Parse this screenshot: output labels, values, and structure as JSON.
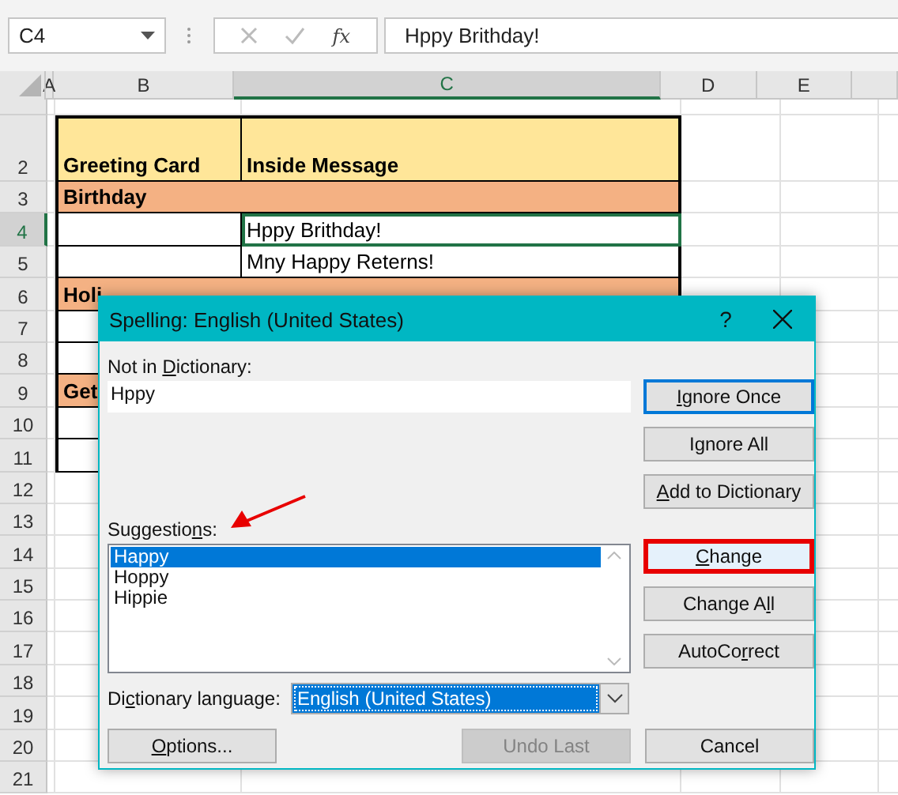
{
  "formula_bar": {
    "name_box": "C4",
    "function_label": "fx",
    "formula": "Hppy Brithday!"
  },
  "columns": [
    {
      "label": "A",
      "selected": false
    },
    {
      "label": "B",
      "selected": false
    },
    {
      "label": "C",
      "selected": true
    },
    {
      "label": "D",
      "selected": false
    },
    {
      "label": "E",
      "selected": false
    }
  ],
  "rows": [
    {
      "number": "2",
      "selected": false,
      "kind": "header",
      "cells": [
        {
          "text": "Greeting Card",
          "selected": false
        },
        {
          "text": "Inside Message",
          "selected": false
        }
      ]
    },
    {
      "number": "3",
      "selected": false,
      "kind": "section",
      "cells": [
        {
          "text": "Birthday",
          "selected": false
        }
      ]
    },
    {
      "number": "4",
      "selected": true,
      "kind": "data",
      "cells": [
        {
          "selected": false
        },
        {
          "text": "Hppy Brithday!",
          "selected": true
        }
      ]
    },
    {
      "number": "5",
      "selected": false,
      "kind": "data",
      "cells": [
        {
          "selected": false
        },
        {
          "text": "Mny Happy Reterns!",
          "selected": false
        }
      ]
    },
    {
      "number": "6",
      "selected": false,
      "kind": "section",
      "cells": [
        {
          "text": "Holi",
          "selected": false
        }
      ]
    },
    {
      "number": "7",
      "selected": false,
      "kind": "boxed"
    },
    {
      "number": "8",
      "selected": false,
      "kind": "boxed"
    },
    {
      "number": "9",
      "selected": false,
      "kind": "section",
      "cells": [
        {
          "text": "Get",
          "selected": false
        }
      ]
    },
    {
      "number": "10",
      "selected": false,
      "kind": "boxed"
    },
    {
      "number": "11",
      "selected": false,
      "kind": "boxed"
    },
    {
      "number": "12",
      "selected": false,
      "kind": "plain"
    },
    {
      "number": "13",
      "selected": false,
      "kind": "plain"
    },
    {
      "number": "14",
      "selected": false,
      "kind": "plain"
    },
    {
      "number": "15",
      "selected": false,
      "kind": "plain"
    },
    {
      "number": "16",
      "selected": false,
      "kind": "plain"
    },
    {
      "number": "17",
      "selected": false,
      "kind": "plain"
    },
    {
      "number": "18",
      "selected": false,
      "kind": "plain"
    },
    {
      "number": "19",
      "selected": false,
      "kind": "plain"
    },
    {
      "number": "20",
      "selected": false,
      "kind": "plain"
    },
    {
      "number": "21",
      "selected": false,
      "kind": "plain"
    }
  ],
  "dialog": {
    "title": "Spelling: English (United States)",
    "help": "?",
    "not_in_dictionary_label": {
      "pre": "Not in ",
      "key": "D",
      "post": "ictionary:"
    },
    "not_in_dictionary": "Hppy",
    "suggestions_label": {
      "pre": "Suggestio",
      "key": "n",
      "post": "s:"
    },
    "suggestions": [
      {
        "text": "Happy",
        "selected": true
      },
      {
        "text": "Hoppy",
        "selected": false
      },
      {
        "text": "Hippie",
        "selected": false
      }
    ],
    "language_label": {
      "pre": "Di",
      "key": "c",
      "post": "tionary language:"
    },
    "language": "English (United States)",
    "side_buttons": [
      {
        "label": {
          "key": "I",
          "post": "gnore Once"
        },
        "focused": true,
        "highlighted": false
      },
      {
        "label": {
          "pre": "I",
          "key": "g",
          "post": "nore All"
        },
        "focused": false,
        "highlighted": false
      },
      {
        "label": {
          "key": "A",
          "post": "dd to Dictionary"
        },
        "focused": false,
        "highlighted": false
      },
      {
        "label": {
          "key": "C",
          "post": "hange"
        },
        "focused": false,
        "highlighted": true
      },
      {
        "label": {
          "pre": "Change A",
          "key": "l",
          "post": "l"
        },
        "focused": false,
        "highlighted": false
      },
      {
        "label": {
          "pre": "AutoCo",
          "key": "r",
          "post": "rect"
        },
        "focused": false,
        "highlighted": false
      }
    ],
    "bottom_buttons": [
      {
        "label": {
          "key": "O",
          "post": "ptions..."
        },
        "disabled": false
      },
      {
        "label": {
          "pre": "Undo Last"
        },
        "disabled": true
      },
      {
        "label": {
          "pre": "Cancel"
        },
        "disabled": false
      }
    ]
  }
}
